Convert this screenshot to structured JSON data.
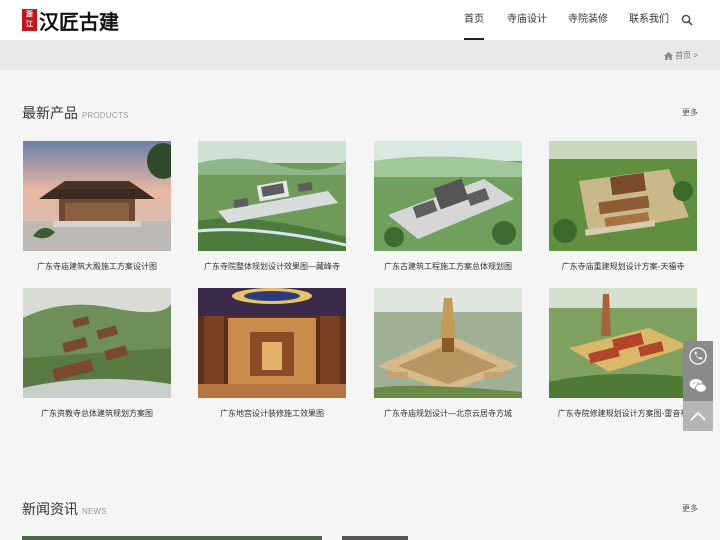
{
  "brand": {
    "seal_line1": "浙",
    "seal_line2": "江",
    "name": "汉匠古建"
  },
  "nav": {
    "items": [
      {
        "label": "首页",
        "active": true
      },
      {
        "label": "寺庙设计",
        "active": false
      },
      {
        "label": "寺院装修",
        "active": false
      },
      {
        "label": "联系我们",
        "active": false
      }
    ],
    "search_icon": "search-icon"
  },
  "breadcrumb": {
    "home_icon": "home-icon",
    "text": "首页 >"
  },
  "products": {
    "title": "最新产品",
    "subtitle": "PRODUCTS",
    "more": "更多",
    "items": [
      {
        "caption": "广东寺庙建筑大殿施工方案设计图"
      },
      {
        "caption": "广东寺院整体规划设计效果图—藏峰寺"
      },
      {
        "caption": "广东古建筑工程施工方案总体规划图"
      },
      {
        "caption": "广东寺庙重建规划设计方案-天福寺"
      },
      {
        "caption": "广东资教寺总体建筑规划方案图"
      },
      {
        "caption": "广东地宫设计装修施工效果图"
      },
      {
        "caption": "广东寺庙规划设计—北京云居寺方城"
      },
      {
        "caption": "广东寺院修建规划设计方案图-雷音禅"
      }
    ]
  },
  "news": {
    "title": "新闻资讯",
    "subtitle": "NEWS",
    "more": "更多"
  },
  "side_tools": [
    "phone-icon",
    "wechat-icon",
    "back-to-top-icon"
  ],
  "colors": {
    "seal_red": "#c4161c",
    "page_bg": "#f5f5f5",
    "crumb_bg": "#e8e8e8",
    "side_tool_bg": "#8a8a8a"
  }
}
